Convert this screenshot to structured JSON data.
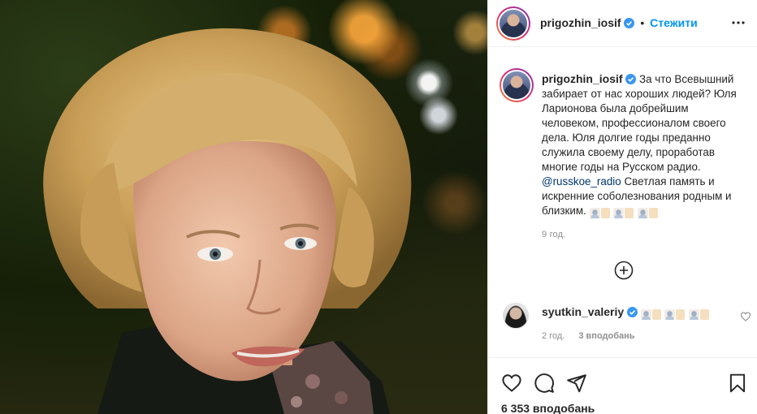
{
  "post": {
    "author": {
      "username": "prigozhin_iosif",
      "verified": true,
      "avatar_icon": "profile-photo"
    },
    "follow_label": "Стежити",
    "separator": "•",
    "more_icon": "more-horizontal-icon",
    "photo": {
      "description_icon": "post-photo"
    },
    "caption": {
      "username": "prigozhin_iosif",
      "text_before_mention": "За что Всевышний забирает от нас хороших людей? Юля Ларионова была добрейшим человеком, профессионалом своего дела. Юля долгие годы преданно служила своему делу, проработав многие годы на Русском радио.",
      "mention": "@russkoe_radio",
      "text_after_mention": "Светлая память и искренние соболезнования родным и близким.",
      "emoji": [
        "folded-hands",
        "folded-hands",
        "folded-hands"
      ],
      "time": "9 год."
    },
    "load_more_icon": "plus-circle-icon",
    "comments": [
      {
        "username": "syutkin_valeriy",
        "verified": true,
        "emoji": [
          "folded-hands",
          "folded-hands",
          "folded-hands"
        ],
        "time": "2 год.",
        "likes": "3 вподобань"
      }
    ],
    "actions": {
      "like_icon": "heart-icon",
      "comment_icon": "comment-icon",
      "share_icon": "share-icon",
      "save_icon": "bookmark-icon"
    },
    "likes_count": "6 353 вподобань",
    "colors": {
      "link_blue": "#0095f6",
      "mention_blue": "#00376b",
      "text": "#262626",
      "muted": "#8e8e8e",
      "border": "#efefef"
    }
  }
}
